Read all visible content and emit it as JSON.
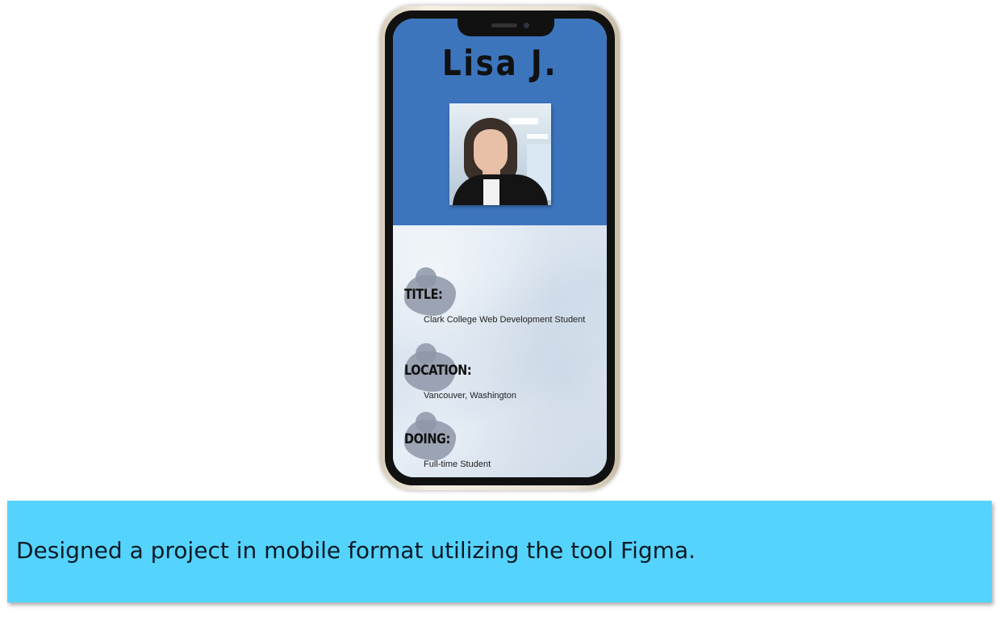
{
  "profile": {
    "name": "Lisa J.",
    "photo_alt": "Portrait photo"
  },
  "fields": [
    {
      "label": "TITLE:",
      "value": "Clark College Web Development Student"
    },
    {
      "label": "LOCATION:",
      "value": "Vancouver, Washington"
    },
    {
      "label": "DOING:",
      "value": "Full-time Student"
    }
  ],
  "caption": {
    "text": "Designed a project in mobile format utilizing the tool Figma."
  },
  "colors": {
    "header_blue": "#3d75bd",
    "caption_bar": "#54d3fd",
    "blob_gray": "#8e97a8"
  }
}
